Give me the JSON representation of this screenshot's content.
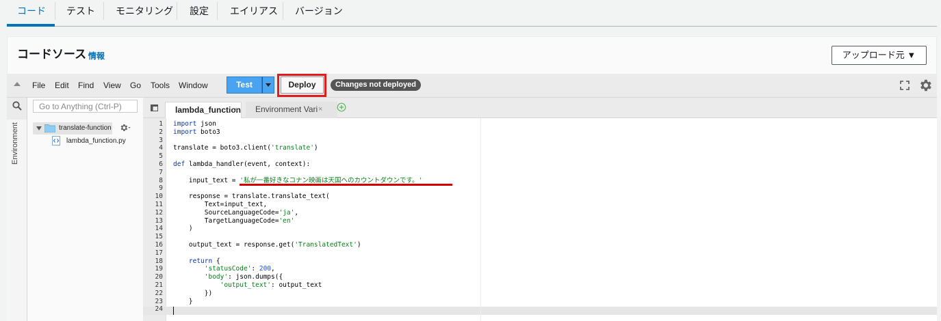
{
  "tabs": [
    {
      "label": "コード",
      "active": true
    },
    {
      "label": "テスト",
      "active": false
    },
    {
      "label": "モニタリング",
      "active": false
    },
    {
      "label": "設定",
      "active": false
    },
    {
      "label": "エイリアス",
      "active": false
    },
    {
      "label": "バージョン",
      "active": false
    }
  ],
  "section": {
    "title": "コードソース",
    "info_link": "情報",
    "upload_button": "アップロード元 ▼"
  },
  "ide": {
    "menu": [
      "File",
      "Edit",
      "Find",
      "View",
      "Go",
      "Tools",
      "Window"
    ],
    "test_button": "Test",
    "deploy_button": "Deploy",
    "status_badge": "Changes not deployed",
    "search_placeholder": "Go to Anything (Ctrl-P)",
    "vertical_tab": "Environment",
    "tree": {
      "root": "translate-function",
      "file": "lambda_function.py"
    },
    "editor_tabs": [
      {
        "label": "lambda_function",
        "close": "×",
        "active": true
      },
      {
        "label": "Environment Vari",
        "close": "×",
        "active": false
      }
    ]
  },
  "code": {
    "line_numbers": [
      "1",
      "2",
      "3",
      "4",
      "5",
      "6",
      "7",
      "8",
      "9",
      "10",
      "11",
      "12",
      "13",
      "14",
      "15",
      "16",
      "17",
      "18",
      "19",
      "20",
      "21",
      "22",
      "23",
      "24"
    ],
    "lines": [
      {
        "pre": "",
        "kw": "import",
        "rest": " json"
      },
      {
        "pre": "",
        "kw": "import",
        "rest": " boto3"
      },
      {
        "plain": ""
      },
      {
        "plain": "translate = boto3.client(",
        "str": "'translate'",
        "post": ")"
      },
      {
        "plain": ""
      },
      {
        "pre": "",
        "kw": "def",
        "rest": " lambda_handler(event, context):"
      },
      {
        "plain": ""
      },
      {
        "plain": "    input_text = ",
        "str": "'私が一番好きなコナン映画は天国へのカウントダウンです。'",
        "post": ""
      },
      {
        "plain": ""
      },
      {
        "plain": "    response = translate.translate_text("
      },
      {
        "plain": "        Text=input_text,"
      },
      {
        "plain": "        SourceLanguageCode=",
        "str": "'ja'",
        "post": ","
      },
      {
        "plain": "        TargetLanguageCode=",
        "str": "'en'",
        "post": ""
      },
      {
        "plain": "    )"
      },
      {
        "plain": ""
      },
      {
        "plain": "    output_text = response.get(",
        "str": "'TranslatedText'",
        "post": ")"
      },
      {
        "plain": ""
      },
      {
        "pre": "    ",
        "kw": "return",
        "rest": " {"
      },
      {
        "pre": "        ",
        "str2": "'statusCode'",
        "mid": ": ",
        "num": "200",
        "end": ","
      },
      {
        "pre": "        ",
        "str2": "'body'",
        "mid": ": json.dumps({",
        "num": "",
        "end": ""
      },
      {
        "pre": "            ",
        "str2": "'output_text'",
        "mid": ": output_text",
        "num": "",
        "end": ""
      },
      {
        "plain": "        })"
      },
      {
        "plain": "    }"
      },
      {
        "plain": ""
      }
    ]
  }
}
